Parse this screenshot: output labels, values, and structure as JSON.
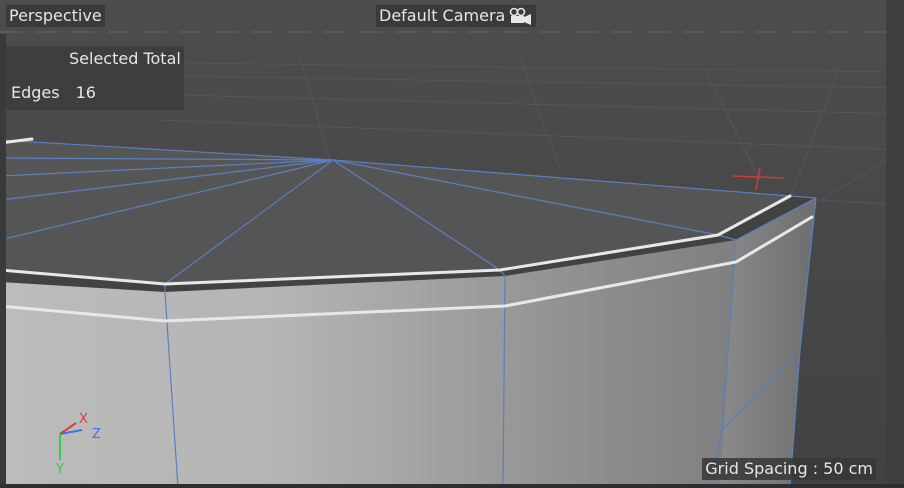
{
  "viewport": {
    "view_name": "Perspective",
    "camera_name": "Default Camera",
    "camera_icon": "camera-icon",
    "grid_spacing": "Grid Spacing : 50 cm"
  },
  "stats": {
    "header": "Selected Total",
    "row_label": "Edges",
    "row_value": "16"
  },
  "axes": {
    "x": "X",
    "y": "Y",
    "z": "Z"
  },
  "colors": {
    "background": "#464646",
    "wire": "#5a7fbf",
    "selected_edge": "#e8e8e8",
    "axis_x": "#e23a3a",
    "axis_y": "#2fd04a",
    "axis_z": "#3a7ae2"
  }
}
